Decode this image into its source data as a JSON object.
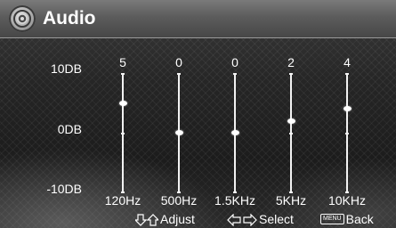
{
  "title": "Audio",
  "icon": "speaker-icon",
  "db_scale": {
    "top": "10DB",
    "middle": "0DB",
    "bottom": "-10DB",
    "max": 10,
    "min": -10
  },
  "bands": [
    {
      "freq": "120Hz",
      "value": 5
    },
    {
      "freq": "500Hz",
      "value": 0
    },
    {
      "freq": "1.5KHz",
      "value": 0
    },
    {
      "freq": "5KHz",
      "value": 2
    },
    {
      "freq": "10KHz",
      "value": 4
    }
  ],
  "value_labels": [
    "5",
    "0",
    "0",
    "2",
    "4"
  ],
  "footer": {
    "adjust_label": "Adjust",
    "adjust_icon": "up-down-arrows-icon",
    "select_label": "Select",
    "select_icon": "left-right-arrows-icon",
    "menu_key": "MENU",
    "back_label": "Back"
  },
  "colors": {
    "title_bar": "#5c5c5c",
    "text": "#ffffff",
    "background": "#262626"
  }
}
